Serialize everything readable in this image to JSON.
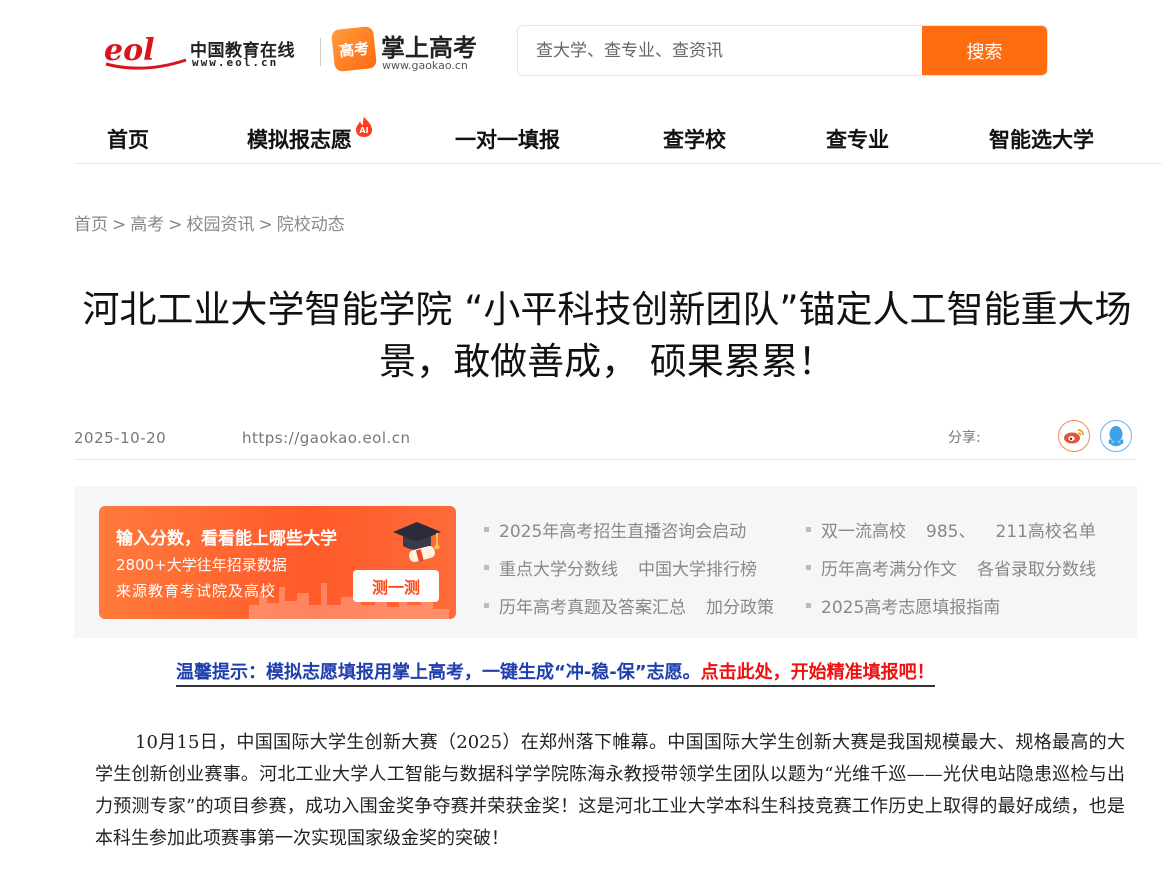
{
  "header": {
    "eol_name": "中国教育在线",
    "eol_url": "www.eol.cn",
    "gk_badge": "高考",
    "gk_name": "掌上高考",
    "gk_url": "www.gaokao.cn",
    "search_placeholder": "查大学、查专业、查资讯",
    "search_button": "搜索",
    "accent_color": "#ff6d10"
  },
  "nav": {
    "items": [
      "首页",
      "模拟报志愿",
      "一对一填报",
      "查学校",
      "查专业",
      "智能选大学"
    ],
    "ai_badge": "AI"
  },
  "breadcrumb": [
    "首页",
    "高考",
    "校园资讯",
    "院校动态"
  ],
  "breadcrumb_sep": ">",
  "article": {
    "title": "河北工业大学智能学院 “小平科技创新团队”锚定人工智能重大场景，敢做善成， 硕果累累！",
    "date": "2025-10-20",
    "source": "https://gaokao.eol.cn",
    "share_label": "分享:",
    "body": "10月15日，中国国际大学生创新大赛（2025）在郑州落下帷幕。中国国际大学生创新大赛是我国规模最大、规格最高的大学生创新创业赛事。河北工业大学人工智能与数据科学学院陈海永教授带领学生团队以题为“光维千巡——光伏电站隐患巡检与出力预测专家”的项目参赛，成功入围金奖争夺赛并荣获金奖！这是河北工业大学本科生科技竞赛工作历史上取得的最好成绩，也是本科生参加此项赛事第一次实现国家级金奖的突破！"
  },
  "promo": {
    "headline": "输入分数，看看能上哪些大学",
    "line1": "2800+大学往年招录数据",
    "line2": "来源教育考试院及高校",
    "button": "测一测",
    "col1": [
      [
        "2025年高考招生直播咨询会启动"
      ],
      [
        "重点大学分数线",
        "中国大学排行榜"
      ],
      [
        "历年高考真题及答案汇总",
        "加分政策"
      ]
    ],
    "col2": [
      [
        "双一流高校",
        "985、",
        "211高校名单"
      ],
      [
        "历年高考满分作文",
        "各省录取分数线"
      ],
      [
        "2025高考志愿填报指南"
      ]
    ]
  },
  "tip": {
    "blue": "温馨提示：模拟志愿填报用掌上高考，一键生成“冲-稳-保”志愿。",
    "red": "点击此处，开始精准填报吧！"
  }
}
